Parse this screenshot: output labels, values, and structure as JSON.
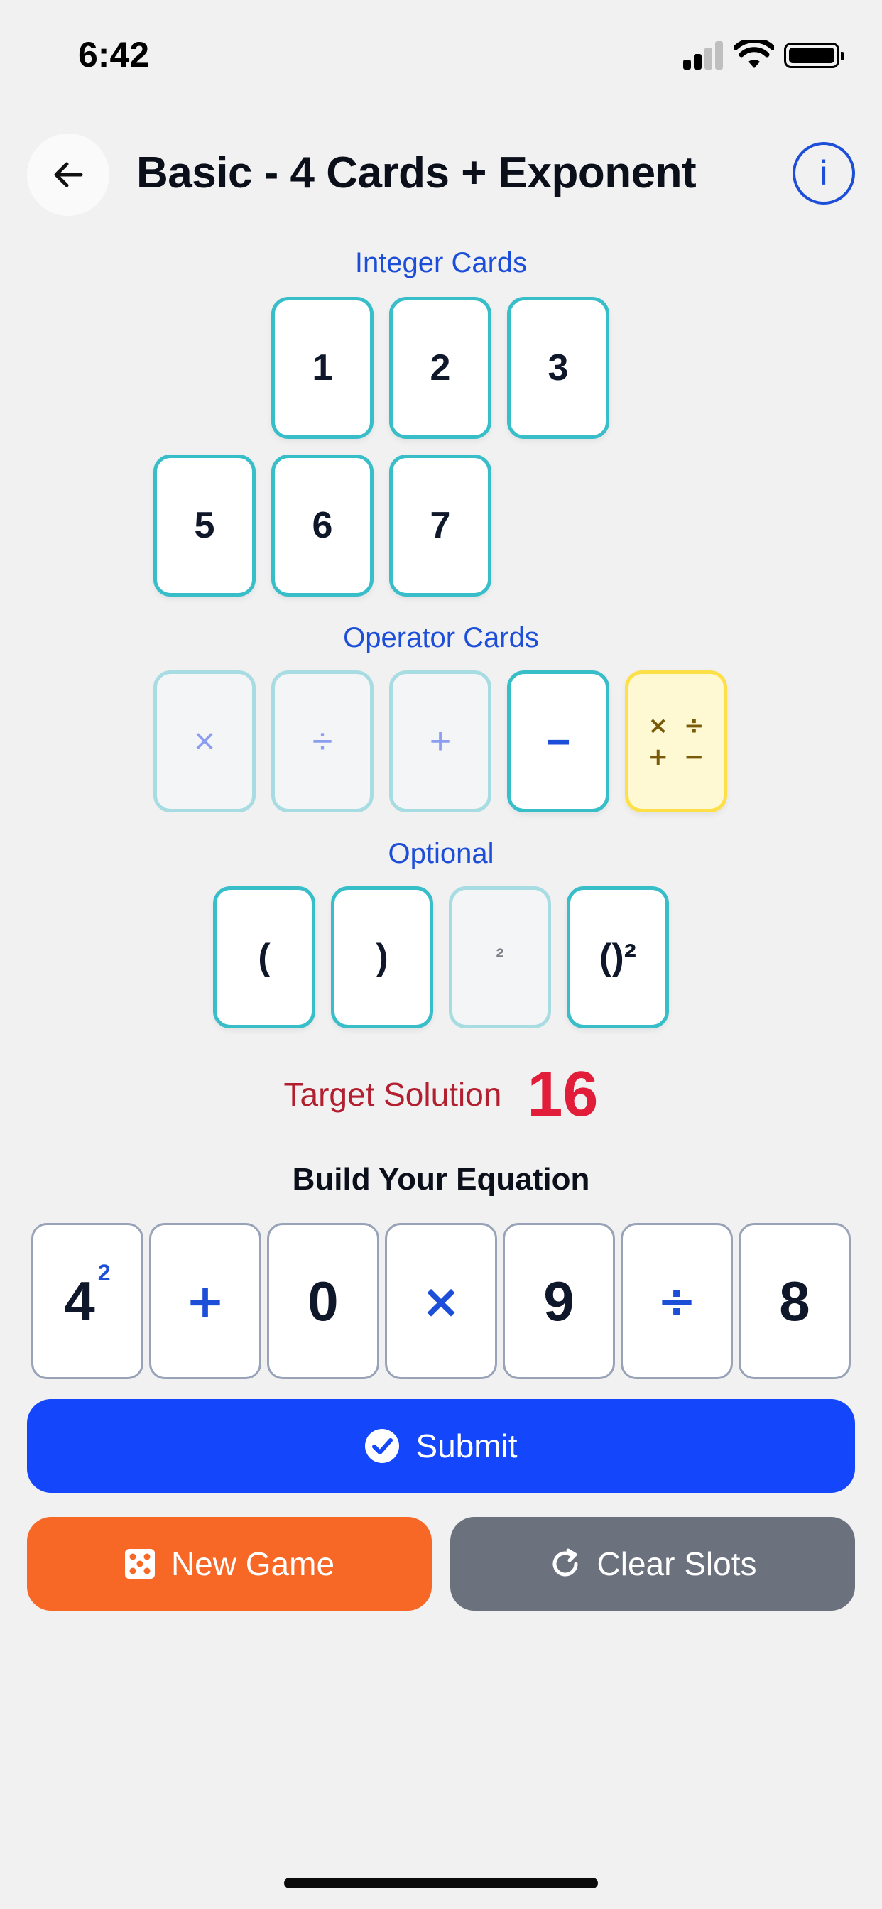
{
  "status_bar": {
    "time": "6:42"
  },
  "header": {
    "title": "Basic - 4 Cards + Exponent",
    "info_label": "i"
  },
  "integer_cards": {
    "label": "Integer Cards",
    "row1": [
      "1",
      "2",
      "3"
    ],
    "row2": [
      "5",
      "6",
      "7"
    ]
  },
  "operator_cards": {
    "label": "Operator Cards",
    "items": [
      {
        "symbol": "×",
        "state": "disabled"
      },
      {
        "symbol": "÷",
        "state": "disabled"
      },
      {
        "symbol": "+",
        "state": "disabled"
      },
      {
        "symbol": "−",
        "state": "active"
      }
    ],
    "special": [
      "×",
      "÷",
      "+",
      "−"
    ]
  },
  "optional_cards": {
    "label": "Optional",
    "items": [
      {
        "symbol": "(",
        "state": "active"
      },
      {
        "symbol": ")",
        "state": "active"
      },
      {
        "symbol": "²",
        "state": "disabled"
      },
      {
        "symbol": "()²",
        "state": "active"
      }
    ]
  },
  "target": {
    "label": "Target Solution",
    "value": "16"
  },
  "equation": {
    "label": "Build Your Equation",
    "slots": [
      {
        "value": "4",
        "exponent": "2"
      },
      {
        "value": "+"
      },
      {
        "value": "0"
      },
      {
        "value": "×"
      },
      {
        "value": "9"
      },
      {
        "value": "÷"
      },
      {
        "value": "8"
      }
    ]
  },
  "buttons": {
    "submit": "Submit",
    "new_game": "New Game",
    "clear_slots": "Clear Slots"
  },
  "colors": {
    "accent": "#1447fb",
    "teal_border": "#38bec9",
    "target_red": "#e11d3a",
    "orange": "#f76827",
    "gray": "#6b717d"
  }
}
